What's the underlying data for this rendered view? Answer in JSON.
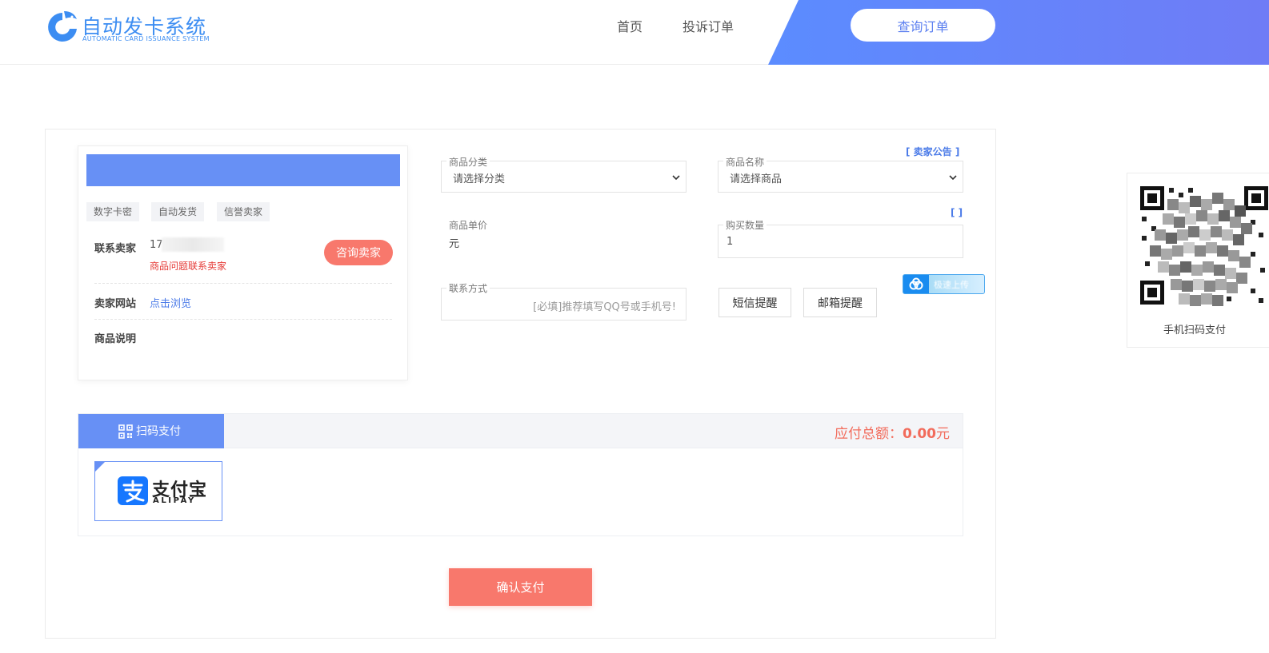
{
  "header": {
    "logo_title": "自动发卡系统",
    "logo_subtitle": "AUTOMATIC CARD ISSUANCE SYSTEM",
    "nav": [
      {
        "label": "首页"
      },
      {
        "label": "投诉订单"
      }
    ],
    "query_button": "查询订单",
    "accent_color": "#5b8cff"
  },
  "seller": {
    "tags": [
      "数字卡密",
      "自动发货",
      "信誉卖家"
    ],
    "contact_label": "联系卖家",
    "contact_value": "17",
    "contact_note": "商品问题联系卖家",
    "consult_button": "咨询卖家",
    "website_label": "卖家网站",
    "website_link": "点击浏览",
    "description_label": "商品说明"
  },
  "form": {
    "category_label": "商品分类",
    "category_value": "请选择分类",
    "product_label": "商品名称",
    "product_value": "请选择商品",
    "notice_link": "[ 卖家公告 ]",
    "price_label": "商品单价",
    "price_value": "元",
    "quantity_bracket": "[ ]",
    "quantity_label": "购买数量",
    "quantity_value": "1",
    "contact_label": "联系方式",
    "contact_placeholder": "[必填]推荐填写QQ号或手机号!",
    "sms_button": "短信提醒",
    "email_button": "邮箱提醒",
    "upload_badge": "极速上传"
  },
  "payment": {
    "tab_label": "扫码支付",
    "total_label": "应付总额：",
    "total_value": "0.00",
    "total_unit": "元",
    "method_cn": "支付宝",
    "method_en": "ALIPAY",
    "confirm_button": "确认支付",
    "alipay_color": "#1677ff",
    "button_color": "#f8786c"
  },
  "qr": {
    "caption": "手机扫码支付"
  }
}
